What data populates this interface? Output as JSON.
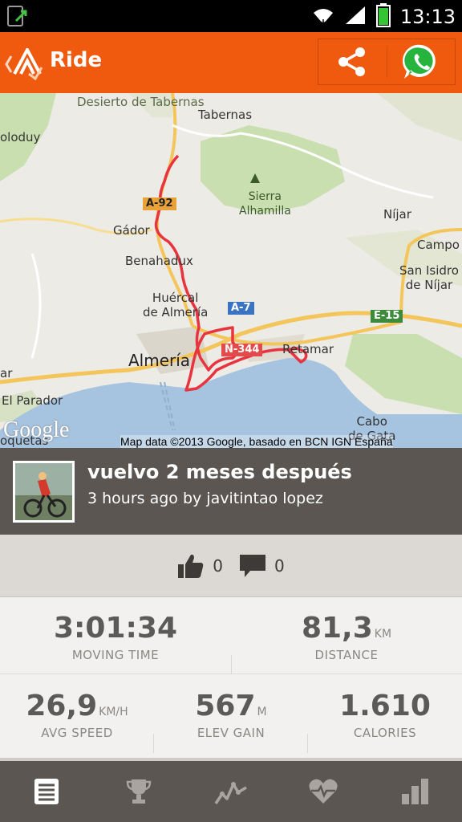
{
  "status_bar": {
    "time": "13:13"
  },
  "action_bar": {
    "title": "Ride"
  },
  "map": {
    "labels": {
      "desierto": "Desierto de\nTabernas",
      "tabernas": "Tabernas",
      "soloduy": "oloduy",
      "sierra": "Sierra\nAlhamilla",
      "nijar": "Níjar",
      "campo": "Campo",
      "san_isidro": "San Isidro\nde Níjar",
      "gador": "Gádor",
      "benahadux": "Benahadux",
      "huercal": "Huércal\nde Almería",
      "almeria": "Almería",
      "retamar": "Retamar",
      "el_parador": "El Parador",
      "ar": "ar",
      "cabo": "Cabo\nde Gata",
      "roquetas": "oquetas"
    },
    "shields": {
      "a92": "A-92",
      "a7": "A-7",
      "n344": "N-344",
      "e15": "E-15"
    },
    "google_logo": "Google",
    "attribution": "Map data ©2013 Google, basado en BCN IGN España"
  },
  "activity": {
    "name": "vuelvo 2 meses después",
    "subtitle": "3 hours ago by javitintao lopez"
  },
  "social": {
    "kudos_count": "0",
    "comments_count": "0"
  },
  "stats": {
    "moving_time": {
      "value": "3:01:34",
      "label": "MOVING TIME"
    },
    "distance": {
      "value": "81,3",
      "unit": "KM",
      "label": "DISTANCE"
    },
    "avg_speed": {
      "value": "26,9",
      "unit": "KM/H",
      "label": "AVG SPEED"
    },
    "elev_gain": {
      "value": "567",
      "unit": "M",
      "label": "ELEV GAIN"
    },
    "calories": {
      "value": "1.610",
      "label": "CALORIES"
    }
  },
  "colors": {
    "accent": "#f05a0f",
    "header_bg": "#5b5651",
    "route": "#e8343f"
  }
}
